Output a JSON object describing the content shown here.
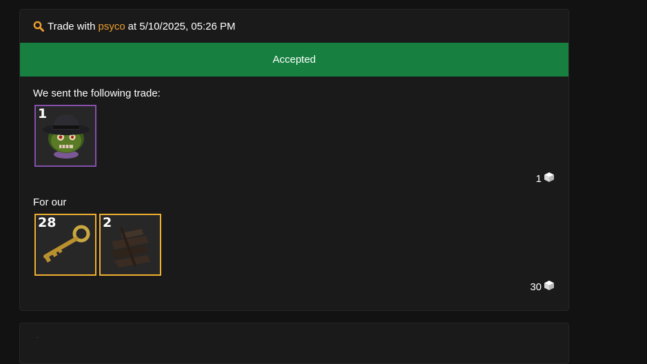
{
  "trade": {
    "prefix": "Trade with",
    "trader": "psyco",
    "at": "at 5/10/2025, 05:26 PM",
    "status": "Accepted",
    "sent_label": "We sent the following trade:",
    "sent_items": [
      {
        "qty": "1",
        "name": "zombie-hat-item",
        "quality_color": "#8650ac"
      }
    ],
    "sent_count": "1",
    "received_label": "For our",
    "received_items": [
      {
        "qty": "28",
        "name": "key-item",
        "quality_color": "#f0b030"
      },
      {
        "qty": "2",
        "name": "metal-item",
        "quality_color": "#f0b030"
      }
    ],
    "received_count": "30"
  },
  "colors": {
    "accent": "#f0a030",
    "accepted": "#178040",
    "background": "#121212",
    "card": "#1a1a1a"
  },
  "icons": {
    "search": "search-icon",
    "cube": "cube-icon"
  }
}
